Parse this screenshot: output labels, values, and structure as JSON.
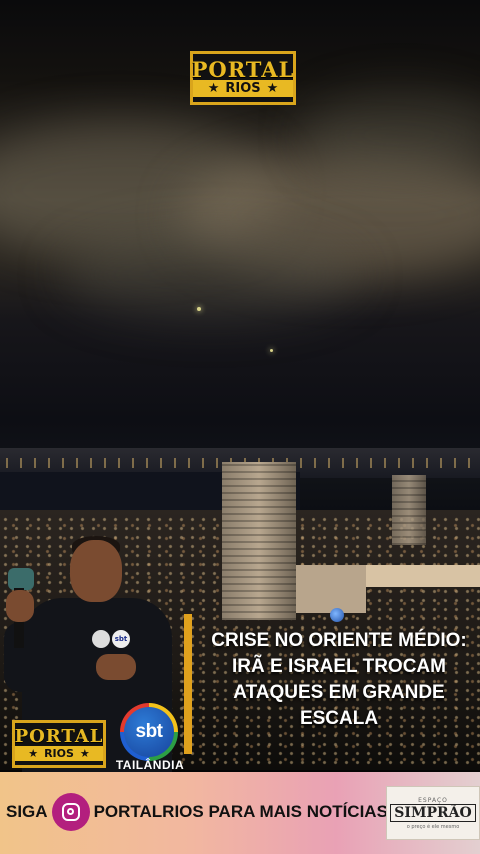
{
  "logo_top": {
    "line1": "PORTAL",
    "line2": "RIOS",
    "stars": "★"
  },
  "logo_bottom": {
    "line1": "PORTAL",
    "line2": "RIOS",
    "stars": "★"
  },
  "headline": {
    "line1": "CRISE NO ORIENTE MÉDIO:",
    "line2": "IRÃ E ISRAEL TROCAM",
    "line3": "ATAQUES EM GRANDE",
    "line4": "ESCALA"
  },
  "network": {
    "logo_text": "sbt",
    "affiliate": "TAILÂNDIA",
    "badge_text": "sbt"
  },
  "banner": {
    "prefix": "SIGA",
    "handle": "PORTALRIOS PARA MAIS NOTÍCIAS",
    "sponsor_top": "ESPAÇO",
    "sponsor_name": "SIMPRÃO",
    "sponsor_sub": "o preço é ele mesmo"
  },
  "icons": [
    "instagram-icon",
    "star-icon"
  ],
  "colors": {
    "accent_gold": "#e0a11d",
    "instagram": "#b31f7e",
    "banner_start": "#f1c489",
    "banner_end": "#e3cfd0"
  }
}
